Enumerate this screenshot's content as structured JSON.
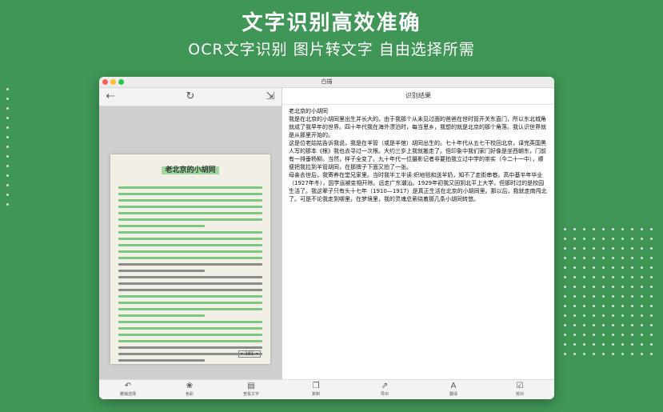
{
  "headline": "文字识别高效准确",
  "subline": "OCR文字识别 图片转文字 自由选择所需",
  "window": {
    "title": "白描"
  },
  "left_toolbar": {
    "back_icon": "back-arrow-icon",
    "rotate_icon": "rotate-icon",
    "export_icon": "export-icon"
  },
  "document": {
    "title": "老北京的小胡同",
    "page_number": "• 181 •"
  },
  "right_pane": {
    "header": "识别结果",
    "text": "老北京的小胡同\n我是在北京的小胡同里出生并长大的。由于我那个从未见过面的爸爸在世时管开关东直门，所以东北城角就成了我早年的世界。四十年代我在海外漂泊时，每当思乡，我想的就是北京的那个角落。我认识世界就是从那里开始的。\n这是位老姑姑告诉我说，我是在羊管（或是羊倌）胡同出生的。七十年代从五七干校回北京，译完英国黑人写的那本《根》我也去寻过一次根。大约三岁上我就搬走了。但印象中我们家门好像是坐西朝东，门前有一排垂杨柳。当然，样子全变了。九十年代一位摄影记者非要拍我立过中学的崇实（今二十一中），顺便把我拉到羊管胡同，在那牌子下面又拍了一张。\n母亲去世后，我寄养在堂兄家里。当时我半工半读:织地毯和送羊奶，知不了走街串巷。高中基半年毕业（1927年冬），因学运被变相开除。远走广东潮汕。1929年初我又回到北平上大学，但那时过的是校园生活了。我这辈子只有头十七年（1910—1917）是真正生活在北京的小胡同里。那以后，我就走南闯北了。可是不论我走到哪里，在梦境里，我的灵魂总萦绕着那几条小胡同转悠。"
  },
  "bottom_bar": {
    "left_items": [
      {
        "label": "撤销选择",
        "icon": "undo-icon"
      },
      {
        "label": "色彩",
        "icon": "color-icon"
      },
      {
        "label": "查看文字",
        "icon": "view-text-icon"
      }
    ],
    "right_items": [
      {
        "label": "复制",
        "icon": "copy-icon"
      },
      {
        "label": "导出",
        "icon": "export-icon"
      },
      {
        "label": "翻译",
        "icon": "translate-icon"
      },
      {
        "label": "校对",
        "icon": "proofread-icon"
      }
    ]
  },
  "colors": {
    "background": "#3f9656",
    "highlight": "#7cc880"
  }
}
